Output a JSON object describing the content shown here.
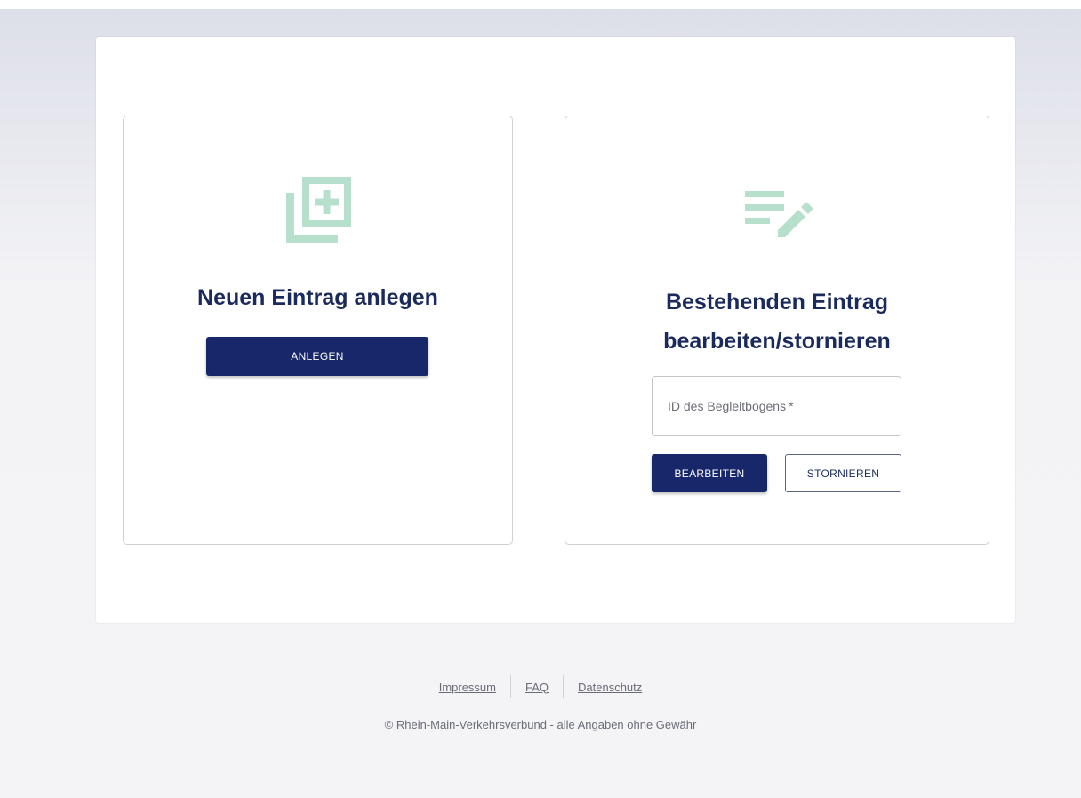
{
  "colors": {
    "primary": "#17276a",
    "title": "#1b2a5c",
    "icon": "#b7e0cc",
    "muted_text": "#6a6d78"
  },
  "new_entry": {
    "icon": "add-to-library-icon",
    "title": "Neuen Eintrag anlegen",
    "button_label": "ANLEGEN"
  },
  "existing_entry": {
    "icon": "edit-list-icon",
    "title": "Bestehenden Eintrag bearbeiten/stornieren",
    "id_field_placeholder": "ID des Begleitbogens",
    "id_field_required_mark": "*",
    "edit_button_label": "BEARBEITEN",
    "cancel_button_label": "STORNIEREN"
  },
  "footer": {
    "links": [
      {
        "label": "Impressum"
      },
      {
        "label": "FAQ"
      },
      {
        "label": "Datenschutz"
      }
    ],
    "copyright": "© Rhein-Main-Verkehrsverbund - alle Angaben ohne Gewähr"
  }
}
